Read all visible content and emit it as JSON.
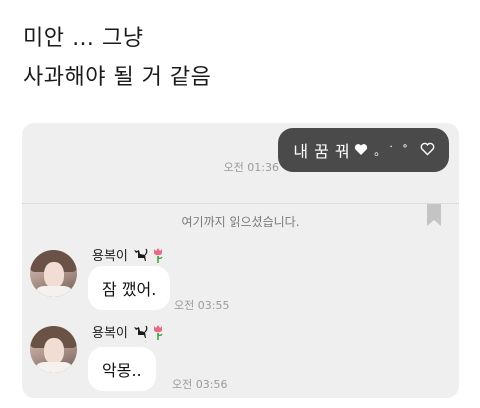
{
  "caption": {
    "line1": "미안 … 그냥",
    "line2": "사과해야 될 거 같음"
  },
  "chat": {
    "sent_message": {
      "text": "내 꿈 꿔",
      "decorations": "。˙ ˚",
      "time": "오전 01:36"
    },
    "read_marker": "여기까지 읽으셨습니다.",
    "received": [
      {
        "sender": "용복이",
        "text": "잠 깼어.",
        "time": "오전 03:55"
      },
      {
        "sender": "용복이",
        "text": "악몽..",
        "time": "오전 03:56"
      }
    ],
    "colors": {
      "sent_bubble": "#4a4a4a",
      "panel_bg": "#efefef",
      "received_bubble": "#ffffff"
    }
  }
}
